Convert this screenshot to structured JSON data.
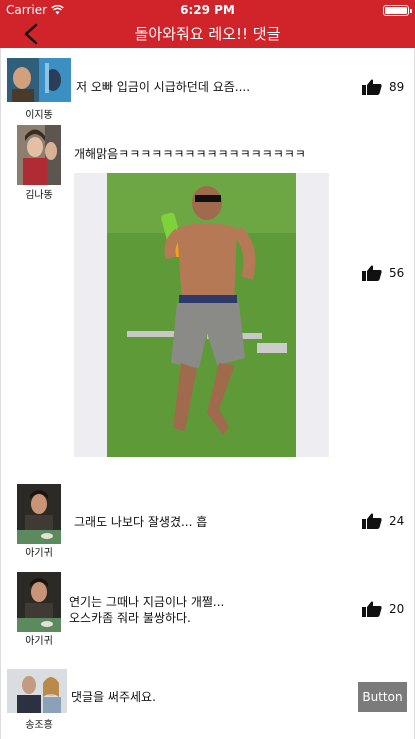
{
  "status_bar": {
    "carrier": "Carrier",
    "time": "6:29 PM"
  },
  "nav": {
    "title": "돌아와줘요 레오!! 댓글",
    "back_icon": "chevron-left-icon"
  },
  "comments": [
    {
      "user": "이지똥",
      "text": "저 오빠 입금이 시급하던데 요즘....",
      "likes": "89"
    },
    {
      "user": "김나똥",
      "text": "개해맑음ㅋㅋㅋㅋㅋㅋㅋㅋㅋㅋㅋㅋㅋㅋㅋㅋㅋ",
      "likes": "56"
    },
    {
      "user": "아기귀",
      "text": "그래도 나보다 잘생겼... 흡",
      "likes": "24"
    },
    {
      "user": "아기귀",
      "text_line1": "연기는 그때나 지금이나 개쩔...",
      "text_line2": "오스카좀 줘라 불쌍하다.",
      "likes": "20"
    }
  ],
  "compose": {
    "user": "송조흥",
    "placeholder": "댓글을 써주세요.",
    "button_label": "Button"
  },
  "colors": {
    "header": "#d0232a",
    "button": "#7b7b7b",
    "photo_bg": "#eeeef2",
    "grass": "#5f9a38"
  }
}
